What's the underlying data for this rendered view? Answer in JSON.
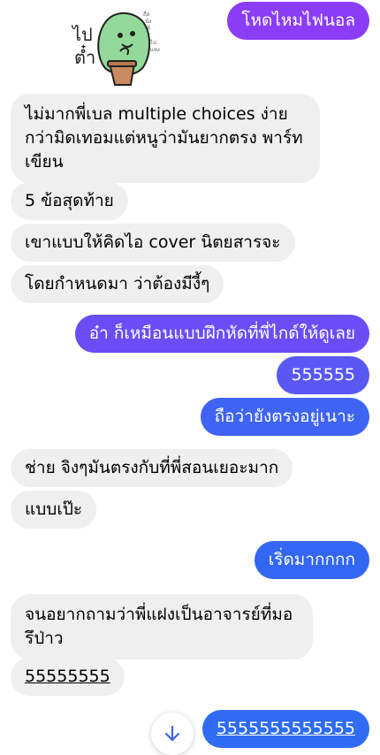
{
  "sticker": {
    "text_left": "ไป ต๋ำ",
    "text_right": "ถือ นั่ง ตี ไป แทง"
  },
  "messages": [
    {
      "text": "โหดไหมไฟนอล",
      "side": "out"
    },
    {
      "text": "ไม่มากพี่เบล multiple choices ง่ายกว่ามิดเทอมแต่หนูว่ามันยากตรง พาร์ทเขียน",
      "side": "in"
    },
    {
      "text": "5 ข้อสุดท้าย",
      "side": "in"
    },
    {
      "text": "เขาแบบให้คิดไอ cover นิตยสารจะ",
      "side": "in"
    },
    {
      "text": "โดยกำหนดมา ว่าต้องมีงี้ๆ",
      "side": "in"
    },
    {
      "text": "อ๋า ก็เหมือนแบบฝึกหัดที่พี่ไกด์ให้ดูเลย",
      "side": "out"
    },
    {
      "text": "555555",
      "side": "out"
    },
    {
      "text": "ถือว่ายังตรงอยู่เนาะ",
      "side": "out"
    },
    {
      "text": "ช่าย จิงๆมันตรงกับที่พี่สอนเยอะมาก",
      "side": "in"
    },
    {
      "text": "แบบเป๊ะ",
      "side": "in"
    },
    {
      "text": "เริ่ดมากกกก",
      "side": "out"
    },
    {
      "text": "จนอยากถามว่าพี่แฝงเป็นอาจารย์ที่มอรึป่าว",
      "side": "in"
    },
    {
      "text": "55555555",
      "side": "in"
    },
    {
      "text": "5555555555555",
      "side": "out"
    }
  ],
  "colors": {
    "out_purple": "#8b3cf7",
    "out_violet": "#6a4df5",
    "out_blue": "#3f63f2",
    "out_bright_blue": "#2f6cf3",
    "incoming": "#efefef"
  },
  "scroll_button": {
    "icon": "arrow-down-icon"
  }
}
